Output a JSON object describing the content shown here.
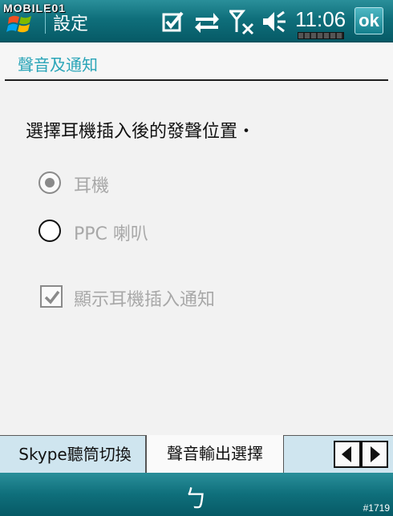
{
  "titlebar": {
    "app_title": "設定",
    "clock": "11:06",
    "ok_label": "ok",
    "watermark": "MOBILE01"
  },
  "header": {
    "title": "聲音及通知"
  },
  "content": {
    "prompt": "選擇耳機插入後的發聲位置・",
    "options": [
      {
        "label": "耳機",
        "selected": true
      },
      {
        "label": "PPC 喇叭",
        "selected": false
      }
    ],
    "checkbox": {
      "label": "顯示耳機插入通知",
      "checked": true
    }
  },
  "tabs": [
    {
      "label": "Skype聽筒切換",
      "active": false
    },
    {
      "label": "聲音輸出選擇",
      "active": true
    }
  ],
  "bottombar": {
    "sip_label": "ㄅ",
    "counter": "#1719"
  },
  "icons": {
    "start": "windows-flag-icon",
    "tasks": "checkbox-tasks-icon",
    "sync": "sync-arrows-icon",
    "signal": "signal-off-icon",
    "volume": "volume-muted-icon",
    "battery": "battery-icon",
    "scroll_left": "tab-scroll-left-icon",
    "scroll_right": "tab-scroll-right-icon"
  },
  "colors": {
    "titlebar": "#0f6f7b",
    "header_text": "#2aa5b8",
    "disabled_text": "#a8a8a8",
    "tab_background": "#cfe5ef"
  }
}
